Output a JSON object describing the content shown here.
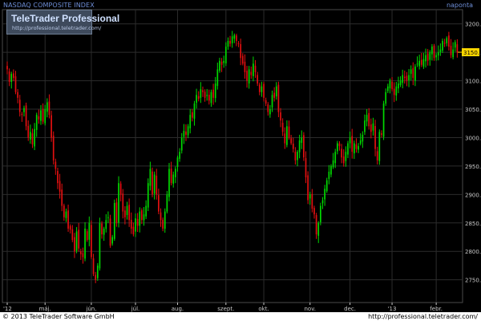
{
  "title": "NASDAQ COMPOSITE INDEX",
  "period": "naponta",
  "logo": {
    "name": "TeleTrader Professional",
    "url": "http://professional.teletrader.com/"
  },
  "footer": {
    "copyright": "© 2013 TeleTrader Software GmbH",
    "url": "http://professional.teletrader.com/"
  },
  "last_price_label": "3150.13",
  "colors": {
    "up": "#00d800",
    "down": "#e01010",
    "grid": "#2c2c2c",
    "axis_text": "#c8c8c8",
    "last_price_bg": "#ffd800",
    "frame": "#4a4a4a"
  },
  "chart_data": {
    "type": "candlestick",
    "title": "NASDAQ COMPOSITE INDEX",
    "ylim": [
      2710,
      3225
    ],
    "y_ticks": [
      2750,
      2800,
      2850,
      2900,
      2950,
      3000,
      3050,
      3100,
      3150,
      3200
    ],
    "y_tick_labels": [
      "2750.00",
      "2800.00",
      "2850.00",
      "2900.00",
      "2950.00",
      "3000.00",
      "3050.00",
      "3100.00",
      "3150.00",
      "3200.00"
    ],
    "x_ticks": [
      {
        "label": "'12",
        "index": 0
      },
      {
        "label": "máj.",
        "index": 18
      },
      {
        "label": "jún.",
        "index": 40
      },
      {
        "label": "júl.",
        "index": 61
      },
      {
        "label": "aug.",
        "index": 81
      },
      {
        "label": "szept.",
        "index": 104
      },
      {
        "label": "okt.",
        "index": 122
      },
      {
        "label": "nov.",
        "index": 144
      },
      {
        "label": "dec.",
        "index": 163
      },
      {
        "label": "'13",
        "index": 183
      },
      {
        "label": "febr.",
        "index": 204
      }
    ],
    "last_price": 3150.13,
    "closes": [
      3120,
      3098,
      3112,
      3105,
      3080,
      3070,
      3045,
      3040,
      3052,
      3020,
      3000,
      3010,
      2988,
      3015,
      3040,
      3032,
      3048,
      3028,
      3050,
      3062,
      3040,
      3000,
      2960,
      2945,
      2920,
      2905,
      2880,
      2860,
      2870,
      2840,
      2838,
      2820,
      2800,
      2835,
      2805,
      2795,
      2790,
      2840,
      2820,
      2850,
      2790,
      2760,
      2750,
      2775,
      2850,
      2830,
      2840,
      2855,
      2860,
      2810,
      2825,
      2885,
      2850,
      2920,
      2900,
      2870,
      2860,
      2880,
      2855,
      2840,
      2830,
      2858,
      2845,
      2870,
      2855,
      2865,
      2880,
      2920,
      2945,
      2900,
      2935,
      2900,
      2870,
      2855,
      2840,
      2870,
      2900,
      2945,
      2920,
      2935,
      2945,
      2965,
      2975,
      3000,
      3012,
      3005,
      3020,
      3040,
      3035,
      3060,
      3075,
      3068,
      3085,
      3080,
      3070,
      3075,
      3065,
      3080,
      3070,
      3095,
      3120,
      3135,
      3128,
      3135,
      3160,
      3170,
      3165,
      3178,
      3180,
      3170,
      3165,
      3140,
      3130,
      3115,
      3100,
      3120,
      3110,
      3130,
      3115,
      3095,
      3080,
      3090,
      3070,
      3060,
      3045,
      3050,
      3075,
      3070,
      3090,
      3045,
      3030,
      3010,
      2990,
      3020,
      3000,
      2990,
      2980,
      2960,
      2975,
      2995,
      3000,
      2965,
      2930,
      2890,
      2900,
      2875,
      2865,
      2830,
      2850,
      2880,
      2890,
      2910,
      2925,
      2940,
      2950,
      2960,
      2975,
      2990,
      2985,
      2965,
      2955,
      2975,
      2990,
      3000,
      2975,
      2990,
      2980,
      2985,
      2995,
      3005,
      3030,
      3040,
      3020,
      3010,
      3025,
      2980,
      2960,
      3010,
      3005,
      3060,
      3080,
      3090,
      3100,
      3085,
      3075,
      3090,
      3095,
      3100,
      3110,
      3105,
      3100,
      3110,
      3120,
      3105,
      3125,
      3130,
      3135,
      3128,
      3138,
      3145,
      3135,
      3150,
      3160,
      3140,
      3145,
      3150,
      3155,
      3170,
      3165,
      3175,
      3160,
      3145,
      3155,
      3168,
      3150
    ]
  }
}
